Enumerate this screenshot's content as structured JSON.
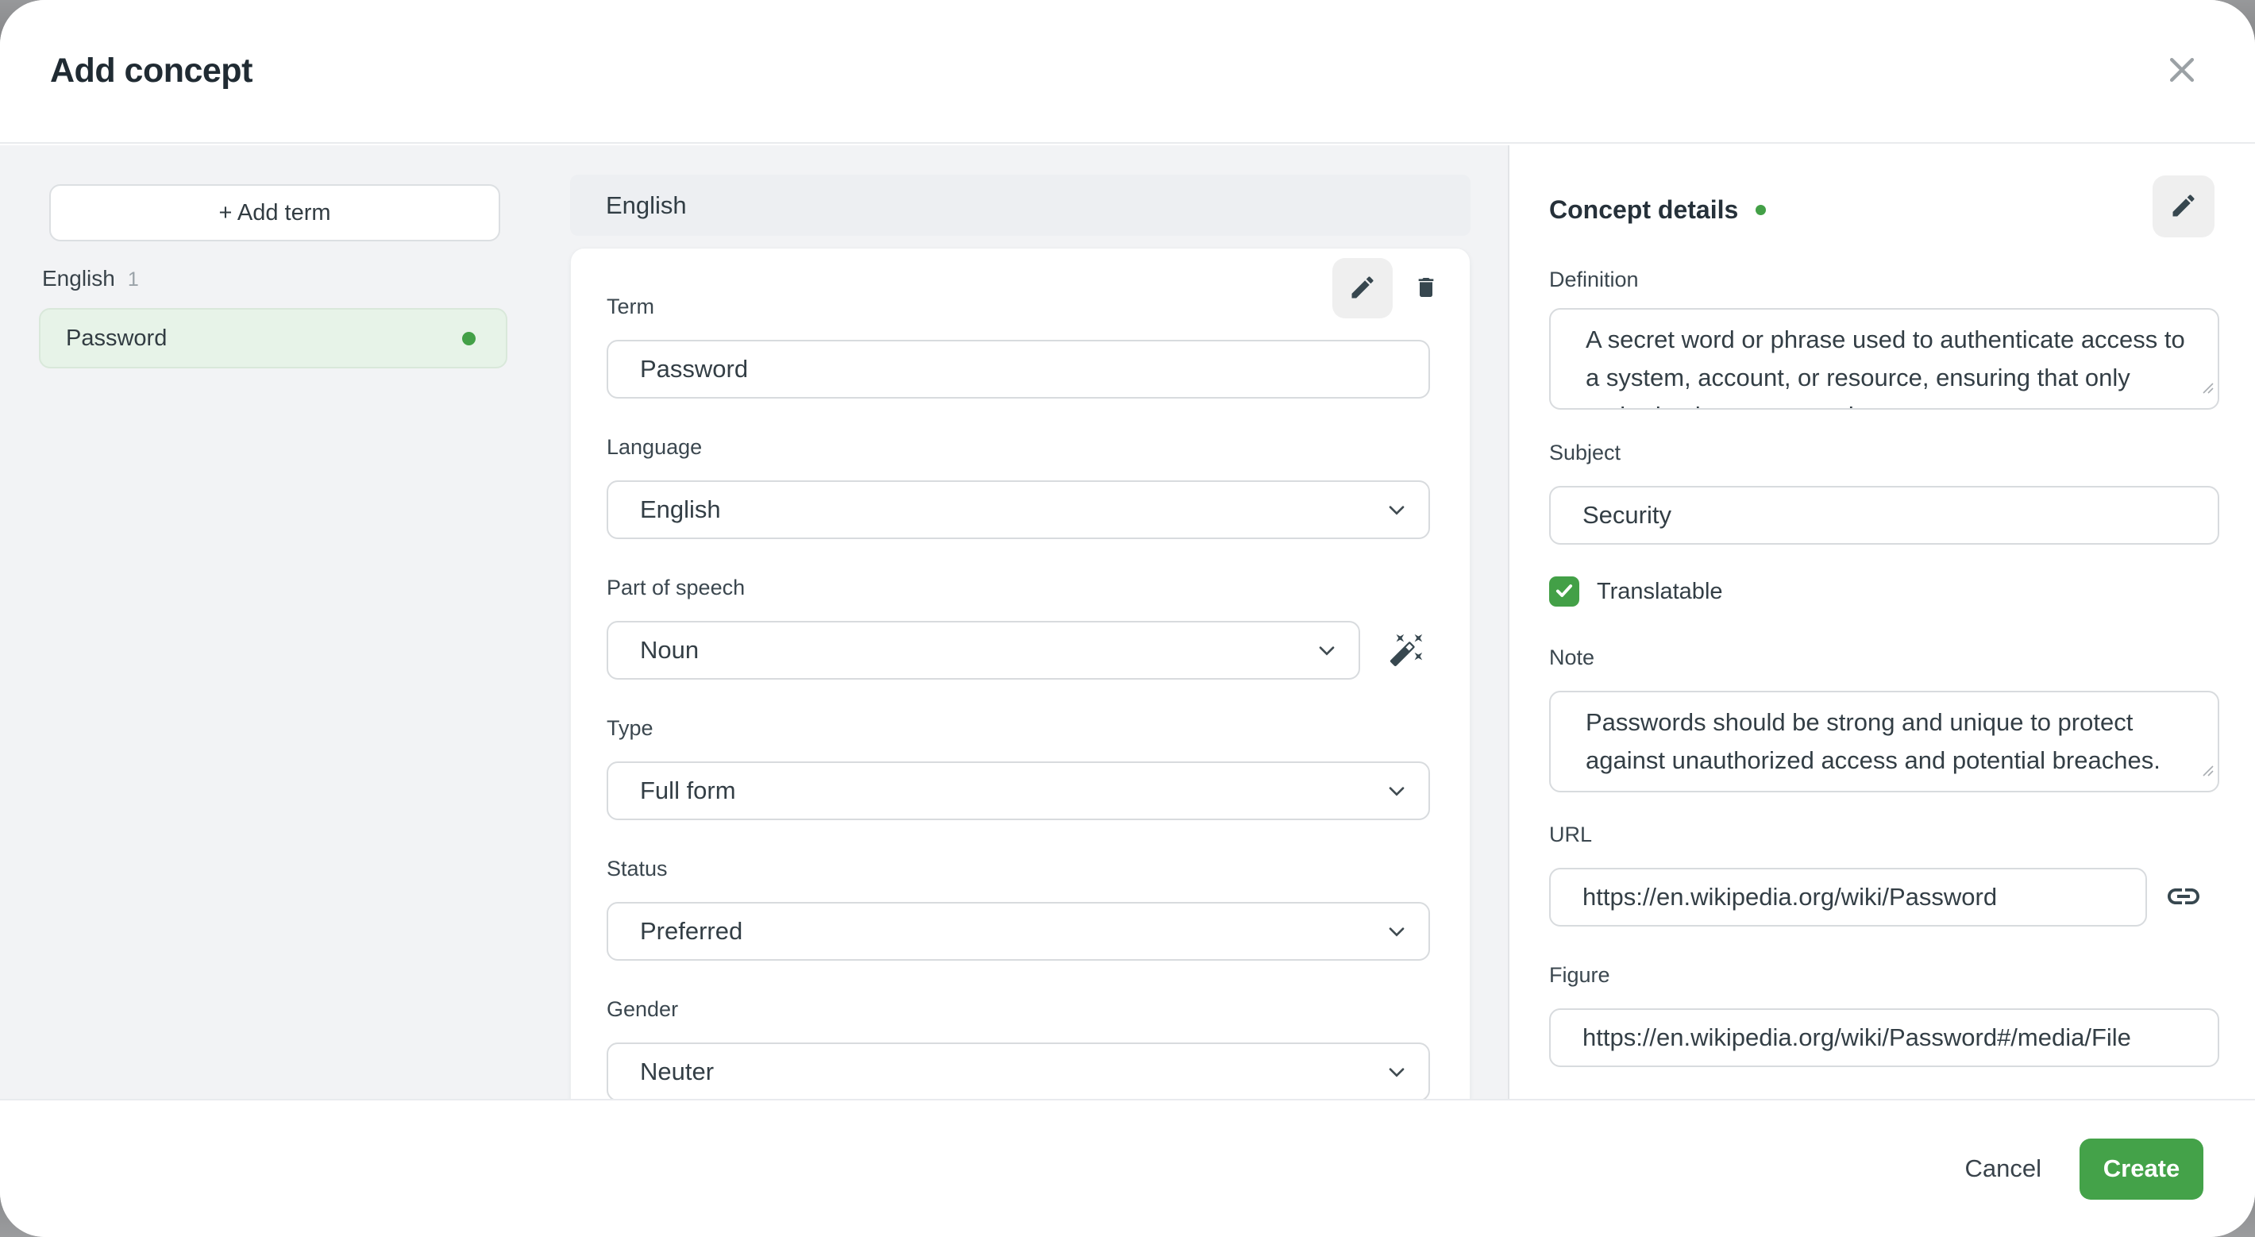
{
  "dialog": {
    "title": "Add concept"
  },
  "colors": {
    "accent_green": "#43a047",
    "selected_term_bg": "#e7f3e8",
    "panel_gray": "#f2f3f5"
  },
  "sidebar": {
    "add_term_button": "+ Add term",
    "group_label": "English",
    "group_count": "1",
    "terms": [
      {
        "label": "Password"
      }
    ]
  },
  "term_panel": {
    "header": "English",
    "fields": {
      "term": {
        "label": "Term",
        "value": "Password"
      },
      "language": {
        "label": "Language",
        "value": "English"
      },
      "part_of_speech": {
        "label": "Part of speech",
        "value": "Noun"
      },
      "type": {
        "label": "Type",
        "value": "Full form"
      },
      "status": {
        "label": "Status",
        "value": "Preferred"
      },
      "gender": {
        "label": "Gender",
        "value": "Neuter"
      }
    }
  },
  "details_panel": {
    "heading": "Concept details",
    "fields": {
      "definition": {
        "label": "Definition",
        "value": "A secret word or phrase used to authenticate access to a system, account, or resource, ensuring that only authorized users can gain entry."
      },
      "subject": {
        "label": "Subject",
        "value": "Security"
      },
      "translatable": {
        "label": "Translatable",
        "checked": true
      },
      "note": {
        "label": "Note",
        "value": "Passwords should be strong and unique to protect against unauthorized access and potential breaches."
      },
      "url": {
        "label": "URL",
        "value": "https://en.wikipedia.org/wiki/Password"
      },
      "figure": {
        "label": "Figure",
        "value": "https://en.wikipedia.org/wiki/Password#/media/File"
      }
    }
  },
  "footer": {
    "cancel_label": "Cancel",
    "create_label": "Create"
  }
}
